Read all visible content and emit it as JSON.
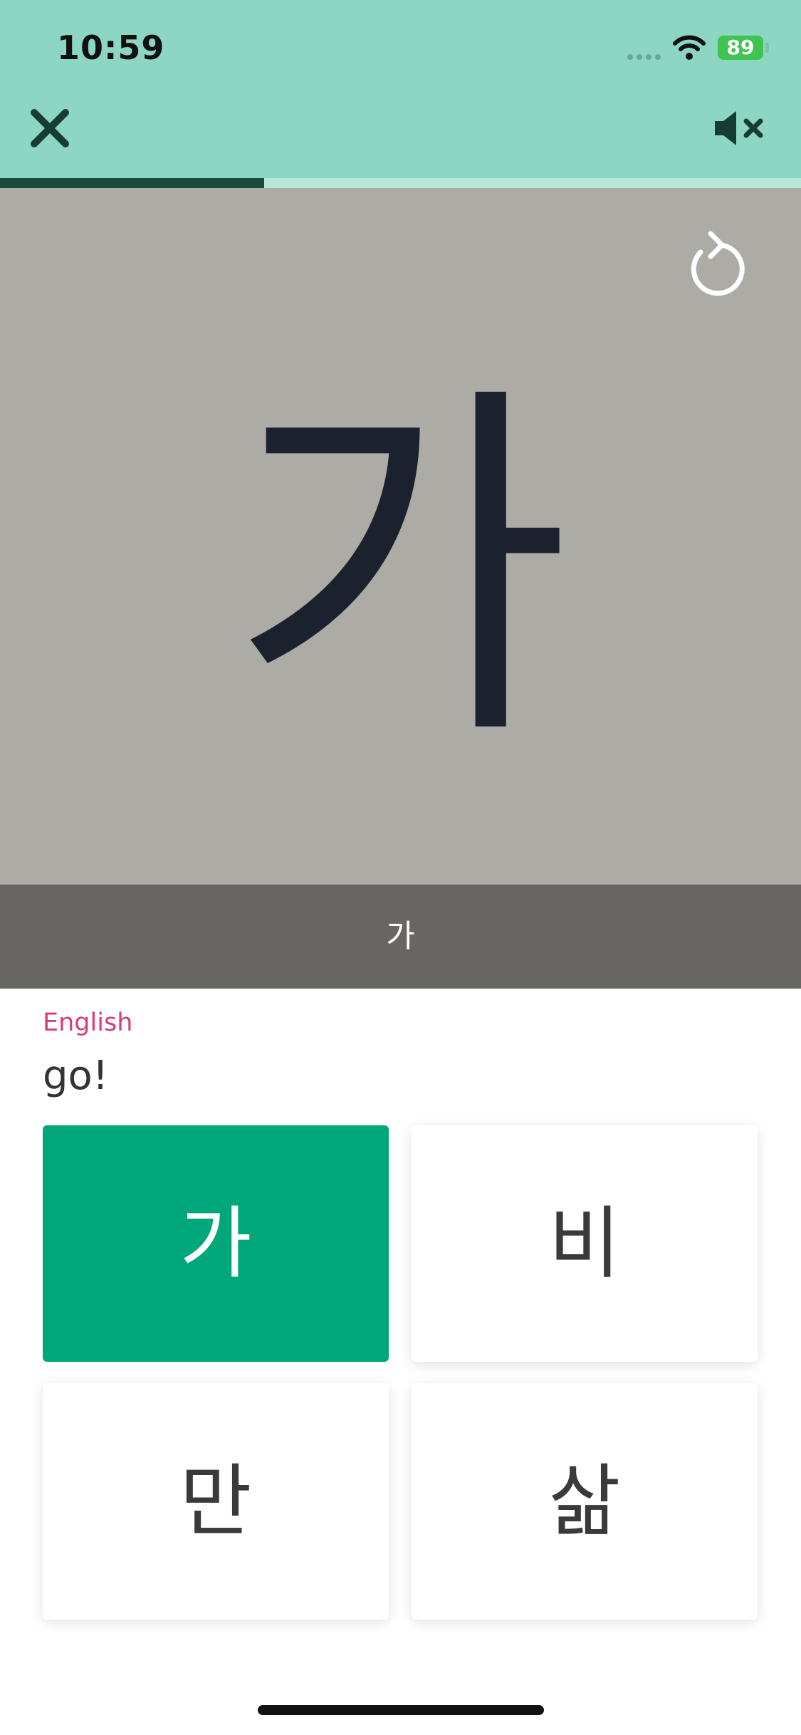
{
  "status_bar": {
    "time": "10:59",
    "battery": "89"
  },
  "header": {
    "close_icon": "close-icon",
    "mute_icon": "speaker-muted-icon"
  },
  "progress": {
    "fraction": 0.33
  },
  "stage": {
    "glyph": "가",
    "replay_icon": "replay-icon",
    "caption": "가"
  },
  "question": {
    "language_label": "English",
    "prompt": "go!"
  },
  "choices": [
    {
      "label": "가",
      "selected": true
    },
    {
      "label": "비",
      "selected": false
    },
    {
      "label": "만",
      "selected": false
    },
    {
      "label": "삶",
      "selected": false
    }
  ],
  "colors": {
    "header_bg": "#8dd6c3",
    "progress_fill": "#1d4a3e",
    "selected_choice": "#00a77a",
    "language_label": "#d63d7f"
  }
}
